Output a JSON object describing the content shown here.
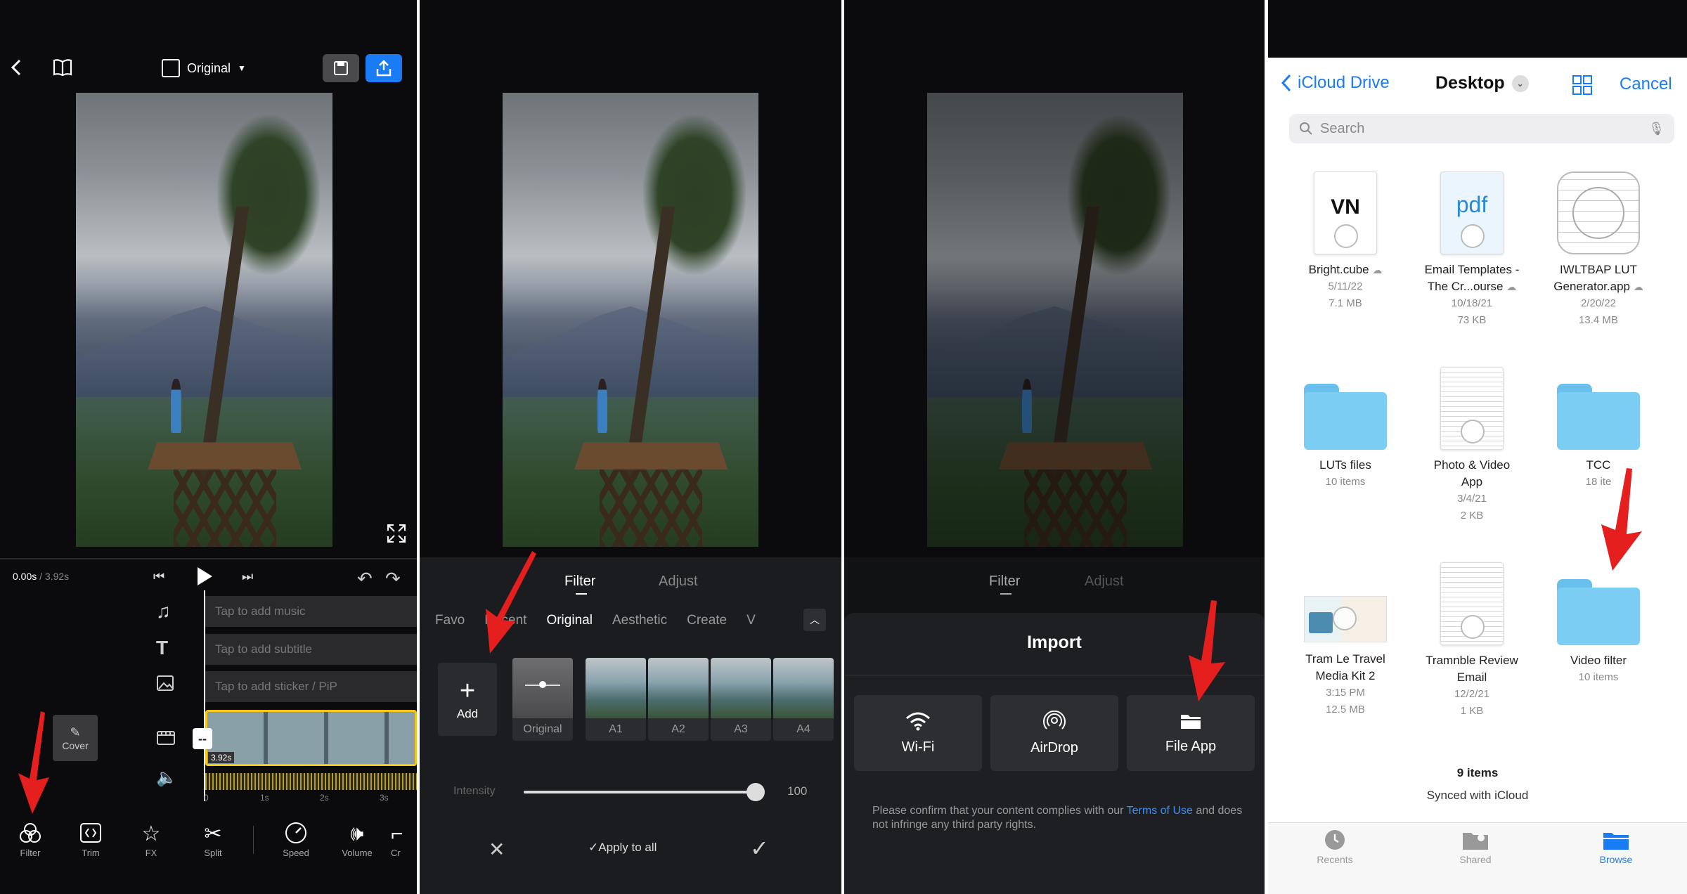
{
  "panel1": {
    "header": {
      "aspect_label": "Original"
    },
    "time": {
      "current": "0.00s",
      "total": "3.92s"
    },
    "tracks": {
      "music": "Tap to add music",
      "subtitle": "Tap to add subtitle",
      "sticker": "Tap to add sticker / PiP"
    },
    "clip": {
      "cover_label": "Cover",
      "duration": "3.92s",
      "ruler": [
        "0",
        "1s",
        "2s",
        "3s"
      ]
    },
    "tools": [
      {
        "label": "Filter",
        "icon": "filter-icon"
      },
      {
        "label": "Trim",
        "icon": "trim-icon"
      },
      {
        "label": "FX",
        "icon": "fx-icon"
      },
      {
        "label": "Split",
        "icon": "scissors-icon"
      },
      {
        "label": "Speed",
        "icon": "speed-icon"
      },
      {
        "label": "Volume",
        "icon": "volume-icon"
      },
      {
        "label": "Cr",
        "icon": "crop-icon"
      }
    ]
  },
  "panel2": {
    "tabs": [
      "Filter",
      "Adjust"
    ],
    "categories": [
      "Favo",
      "Recent",
      "Original",
      "Aesthetic",
      "Create",
      "V"
    ],
    "active_category": "Original",
    "add_label": "Add",
    "thumbs": [
      "Original",
      "A1",
      "A2",
      "A3",
      "A4"
    ],
    "intensity_label": "Intensity",
    "intensity_value": "100",
    "intensity_fraction": 1.0,
    "apply_all": "Apply to all"
  },
  "panel3": {
    "tabs": [
      "Filter",
      "Adjust"
    ],
    "title": "Import",
    "options": [
      "Wi-Fi",
      "AirDrop",
      "File App"
    ],
    "notice_prefix": "Please confirm that your content complies with our",
    "terms_link": "Terms of Use",
    "notice_suffix": "and does not infringe any third party rights."
  },
  "panel4": {
    "back_label": "iCloud Drive",
    "title": "Desktop",
    "cancel_label": "Cancel",
    "search_placeholder": "Search",
    "items": [
      {
        "name1": "Bright.cube",
        "name2": "",
        "meta1": "5/11/22",
        "meta2": "7.1 MB",
        "kind": "vn"
      },
      {
        "name1": "Email Templates -",
        "name2": "The Cr...ourse",
        "meta1": "10/18/21",
        "meta2": "73 KB",
        "kind": "pdf"
      },
      {
        "name1": "IWLTBAP LUT",
        "name2": "Generator.app",
        "meta1": "2/20/22",
        "meta2": "13.4 MB",
        "kind": "app"
      },
      {
        "name1": "LUTs files",
        "name2": "",
        "meta1": "10 items",
        "meta2": "",
        "kind": "folder"
      },
      {
        "name1": "Photo & Video",
        "name2": "App",
        "meta1": "3/4/21",
        "meta2": "2 KB",
        "kind": "doc"
      },
      {
        "name1": "TCC",
        "name2": "",
        "meta1": "18 ite",
        "meta2": "",
        "kind": "folder"
      },
      {
        "name1": "Tram Le Travel",
        "name2": "Media Kit 2",
        "meta1": "3:15 PM",
        "meta2": "12.5 MB",
        "kind": "media"
      },
      {
        "name1": "Tramnble Review",
        "name2": "Email",
        "meta1": "12/2/21",
        "meta2": "1 KB",
        "kind": "doc"
      },
      {
        "name1": "Video filter",
        "name2": "",
        "meta1": "10 items",
        "meta2": "",
        "kind": "folder"
      }
    ],
    "vn_text": "VN",
    "pdf_text": "pdf",
    "count": "9 items",
    "sync": "Synced with iCloud",
    "tabs": [
      "Recents",
      "Shared",
      "Browse"
    ],
    "accent": "#1a7cf5"
  }
}
